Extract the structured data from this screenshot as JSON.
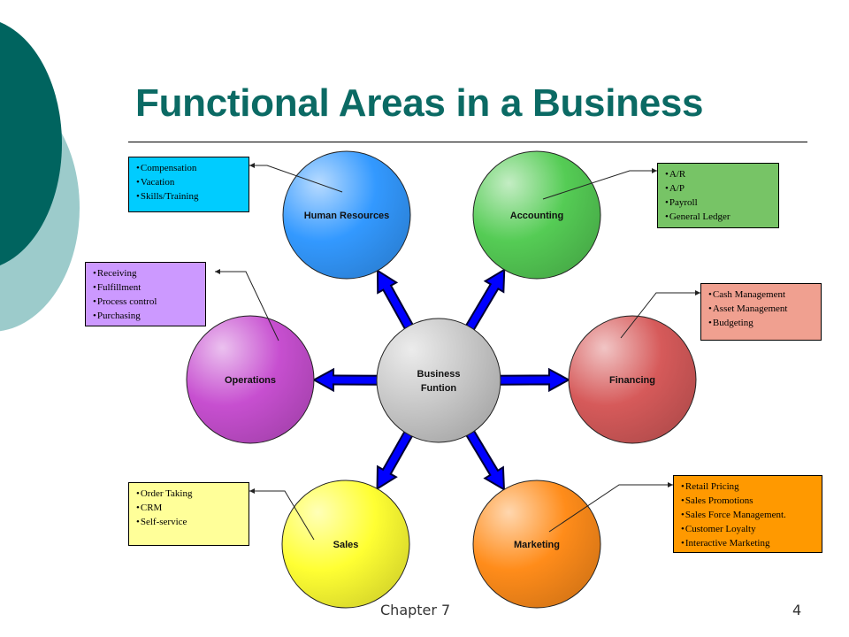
{
  "slide": {
    "title": "Functional Areas in a Business",
    "footer": {
      "chapter": "Chapter 7",
      "page_number": "4"
    }
  },
  "center": {
    "label_line1": "Business",
    "label_line2": "Funtion",
    "color": "#c8c8c8"
  },
  "areas": [
    {
      "id": "hr",
      "label": "Human Resources",
      "color": "#3399ff",
      "box_color": "#00ccff",
      "items": [
        "Compensation",
        "Vacation",
        "Skills/Training"
      ]
    },
    {
      "id": "accounting",
      "label": "Accounting",
      "color": "#55cc55",
      "box_color": "#77c466",
      "items": [
        "A/R",
        "A/P",
        "Payroll",
        "General Ledger"
      ]
    },
    {
      "id": "operations",
      "label": "Operations",
      "color": "#c74fd0",
      "box_color": "#cc99ff",
      "items": [
        "Receiving",
        "Fulfillment",
        "Process control",
        "Purchasing"
      ]
    },
    {
      "id": "financing",
      "label": "Financing",
      "color": "#d65a5a",
      "box_color": "#f0a090",
      "items": [
        "Cash Management",
        "Asset Management",
        "Budgeting"
      ]
    },
    {
      "id": "sales",
      "label": "Sales",
      "color": "#ffff33",
      "box_color": "#ffff99",
      "items": [
        "Order Taking",
        "CRM",
        "Self-service"
      ]
    },
    {
      "id": "marketing",
      "label": "Marketing",
      "color": "#ff8c1a",
      "box_color": "#ff9900",
      "items": [
        "Retail Pricing",
        "Sales Promotions",
        "Sales Force Management.",
        "Customer Loyalty",
        "Interactive Marketing"
      ]
    }
  ],
  "arrow_color": "#0000ff",
  "theme": {
    "title_color": "#0b6a64",
    "deco_dark": "#00645f",
    "deco_light": "#9ccbcb"
  }
}
